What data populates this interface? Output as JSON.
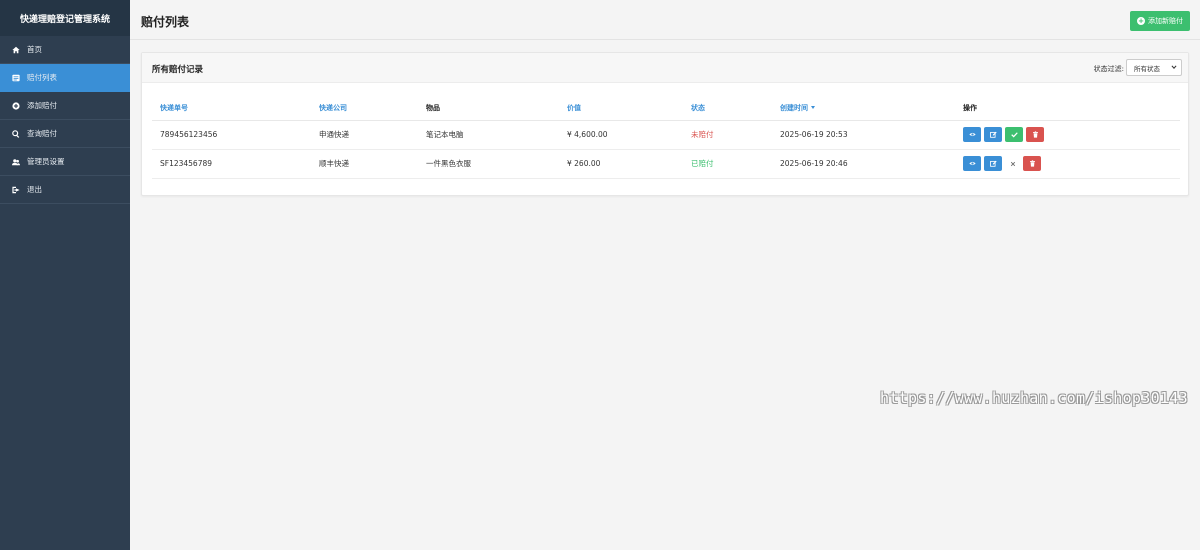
{
  "app": {
    "brand": "快递理赔登记管理系统"
  },
  "sidebar": {
    "items": [
      {
        "label": "首页",
        "icon": "home-icon",
        "active": false
      },
      {
        "label": "赔付列表",
        "icon": "list-icon",
        "active": true
      },
      {
        "label": "添加赔付",
        "icon": "plus-circle-icon",
        "active": false
      },
      {
        "label": "查询赔付",
        "icon": "search-icon",
        "active": false
      },
      {
        "label": "管理员设置",
        "icon": "users-icon",
        "active": false
      },
      {
        "label": "退出",
        "icon": "sign-out-icon",
        "active": false
      }
    ]
  },
  "header": {
    "title": "赔付列表",
    "add_button": "添加新赔付"
  },
  "card": {
    "title": "所有赔付记录",
    "filter_label": "状态过滤:",
    "filter_selected": "所有状态"
  },
  "table": {
    "headers": [
      "快递单号",
      "快递公司",
      "物品",
      "价值",
      "状态",
      "创建时间",
      "操作"
    ],
    "rows": [
      {
        "tracking": "789456123456",
        "company": "申通快递",
        "item": "笔记本电脑",
        "value": "¥ 4,600.00",
        "status": "未赔付",
        "created": "2025-06-19 20:53"
      },
      {
        "tracking": "SF123456789",
        "company": "顺丰快递",
        "item": "一件黑色衣服",
        "value": "¥ 260.00",
        "status": "已赔付",
        "created": "2025-06-19 20:46"
      }
    ]
  },
  "colors": {
    "sidebar": "#2e3e50",
    "accent": "#3a8fd6",
    "success": "#3cbf6f",
    "danger": "#d9534f"
  },
  "watermark": "https://www.huzhan.com/ishop30143"
}
